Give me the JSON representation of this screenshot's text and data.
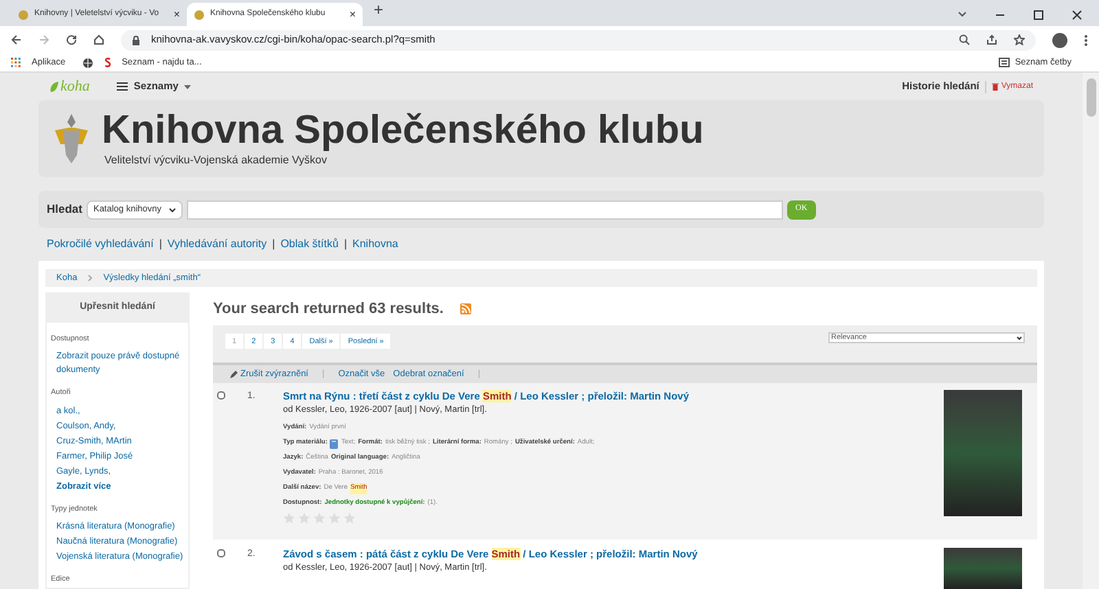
{
  "browser": {
    "tabs": [
      {
        "title": "Knihovny | Veletelství výcviku - Vo",
        "close": "×",
        "selected": false
      },
      {
        "title": "Knihovna Společenského klubu",
        "close": "×",
        "selected": true
      }
    ],
    "new_tab": "+",
    "url": "knihovna-ak.vavyskov.cz/cgi-bin/koha/opac-search.pl?q=smith",
    "bookmarks": [
      "Aplikace",
      "Seznam - najdu ta..."
    ],
    "reading_list": "Seznam četby"
  },
  "navbar": {
    "logo": "koha",
    "lists_menu": "Seznamy",
    "history": "Historie hledání",
    "clear": "Vymazat"
  },
  "header": {
    "title": "Knihovna Společenského klubu",
    "subtitle": "Velitelství výcviku-Vojenská akademie Vyškov"
  },
  "search": {
    "label": "Hledat",
    "scope": "Katalog knihovny",
    "button": "OK"
  },
  "links": [
    {
      "text": "Pokročilé vyhledávání",
      "kind": "link"
    },
    {
      "text": "|",
      "kind": "separator"
    },
    {
      "text": "Vyhledávání autority",
      "kind": "link"
    },
    {
      "text": "|",
      "kind": "separator"
    },
    {
      "text": "Oblak štítků",
      "kind": "link"
    },
    {
      "text": "|",
      "kind": "separator"
    },
    {
      "text": "Knihovna",
      "kind": "link"
    }
  ],
  "breadcrumb": [
    "Koha",
    "Výsledky hledání „smith“"
  ],
  "sidebar": {
    "title": "Upřesnit hledání",
    "groups": [
      {
        "heading": "Dostupnost",
        "items": [
          {
            "text": "Zobrazit pouze právě dostupné dokumenty",
            "kind": "link"
          }
        ]
      },
      {
        "heading": "Autoři",
        "items": [
          {
            "text": "a kol.,",
            "kind": "link"
          },
          {
            "text": "Coulson, Andy,",
            "kind": "link"
          },
          {
            "text": "Cruz-Smith, MArtin",
            "kind": "link"
          },
          {
            "text": "Farmer, Philip José",
            "kind": "link"
          },
          {
            "text": "Gayle, Lynds,",
            "kind": "link"
          },
          {
            "text": "Zobrazit více",
            "kind": "more"
          }
        ]
      },
      {
        "heading": "Typy jednotek",
        "items": [
          {
            "text": "Krásná literatura (Monografie)",
            "kind": "link"
          },
          {
            "text": "Naučná literatura (Monografie)",
            "kind": "link"
          },
          {
            "text": "Vojenská literatura (Monografie)",
            "kind": "link"
          }
        ]
      },
      {
        "heading": "Edice"
      }
    ]
  },
  "results": {
    "summary": "Your search returned 63 results.",
    "pages": [
      {
        "label": "1",
        "selected": true
      },
      {
        "label": "2",
        "selected": false
      },
      {
        "label": "3",
        "selected": false
      },
      {
        "label": "4",
        "selected": false
      },
      {
        "label": "Další »",
        "selected": false
      },
      {
        "label": "Poslední »",
        "selected": false
      }
    ],
    "sort": "Relevance",
    "toolbar": [
      {
        "text": "Zrušit zvýraznění",
        "kind": "action"
      },
      {
        "text": "|",
        "kind": "separator"
      },
      {
        "text": "Označit vše",
        "kind": "link"
      },
      {
        "text": "Odebrat označení",
        "kind": "link"
      },
      {
        "text": "|",
        "kind": "separator"
      }
    ],
    "items": [
      {
        "number": "1.",
        "checked": false,
        "title": [
          {
            "text": "Smrt na Rýnu : třetí část z cyklu De Vere ",
            "highlight": false
          },
          {
            "text": "Smith",
            "highlight": true
          },
          {
            "text": " / Leo Kessler ; přeložil: Martin Nový",
            "highlight": false
          }
        ],
        "authors": "od Kessler, Leo, 1926-2007 [aut] | Nový, Martin [trl].",
        "details": [
          [
            {
              "kind": "label",
              "text": "Vydání:"
            },
            {
              "kind": "value",
              "text": "Vydání první"
            }
          ],
          [
            {
              "kind": "label",
              "text": "Typ materiálu:"
            },
            {
              "kind": "book-icon"
            },
            {
              "kind": "value",
              "text": "Text;"
            },
            {
              "kind": "label",
              "text": "Formát:"
            },
            {
              "kind": "value",
              "text": "tisk běžný tisk ;"
            },
            {
              "kind": "label",
              "text": "Literární forma:"
            },
            {
              "kind": "value",
              "text": "Romány ;"
            },
            {
              "kind": "label",
              "text": "Uživatelské určení:"
            },
            {
              "kind": "value",
              "text": "Adult;"
            }
          ],
          [
            {
              "kind": "label",
              "text": "Jazyk:"
            },
            {
              "kind": "value",
              "text": "Čeština"
            },
            {
              "kind": "label",
              "text": "Original language:"
            },
            {
              "kind": "value",
              "text": "Angličtina"
            }
          ],
          [
            {
              "kind": "label",
              "text": "Vydavatel:"
            },
            {
              "kind": "value",
              "text": "Praha : Baronet, 2016"
            }
          ],
          [
            {
              "kind": "label",
              "text": "Další název:"
            },
            {
              "kind": "value",
              "text": "De Vere"
            },
            {
              "kind": "highlight",
              "text": "Smith"
            }
          ],
          [
            {
              "kind": "label",
              "text": "Dostupnost:"
            },
            {
              "kind": "available",
              "text": "Jednotky dostupné k vypůjčení:"
            },
            {
              "kind": "value",
              "text": "(1)."
            }
          ]
        ],
        "stars": 0
      },
      {
        "number": "2.",
        "checked": false,
        "title": [
          {
            "text": "Závod s časem : pátá část z cyklu De Vere ",
            "highlight": false
          },
          {
            "text": "Smith",
            "highlight": true
          },
          {
            "text": " / Leo Kessler ; přeložil: Martin Nový",
            "highlight": false
          }
        ],
        "authors": "od Kessler, Leo, 1926-2007 [aut] | Nový, Martin [trl]."
      }
    ]
  }
}
